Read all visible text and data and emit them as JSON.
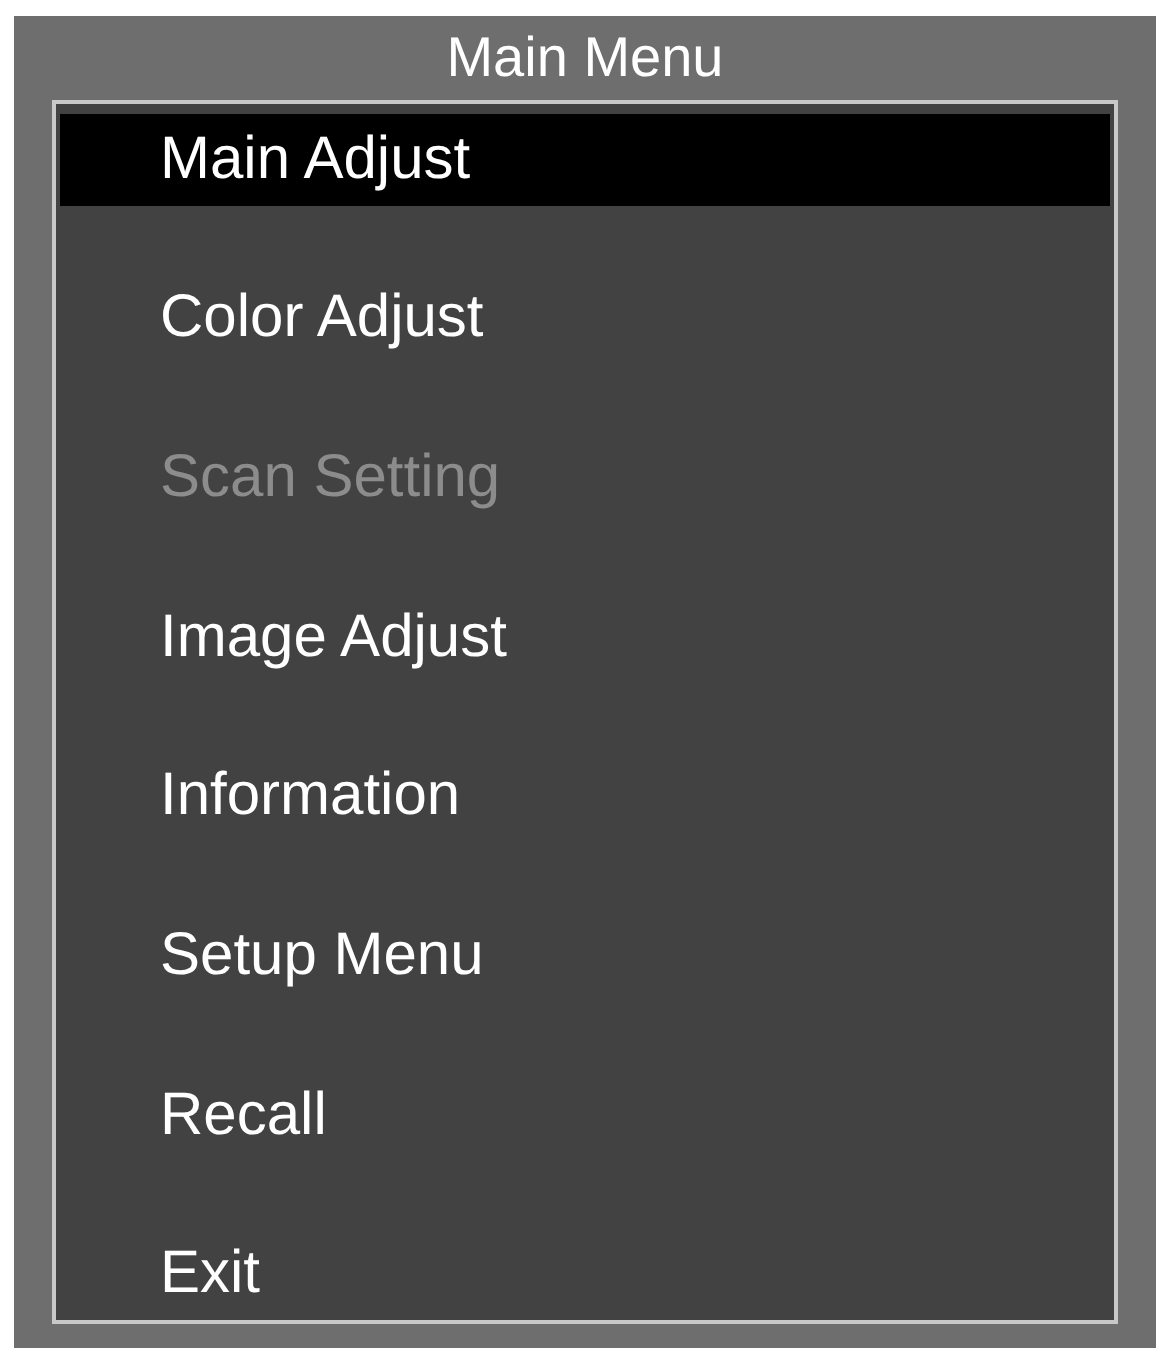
{
  "title": "Main Menu",
  "items": [
    {
      "label": "Main Adjust",
      "selected": true,
      "disabled": false
    },
    {
      "label": "Color Adjust",
      "selected": false,
      "disabled": false
    },
    {
      "label": "Scan Setting",
      "selected": false,
      "disabled": true
    },
    {
      "label": "Image Adjust",
      "selected": false,
      "disabled": false
    },
    {
      "label": "Information",
      "selected": false,
      "disabled": false
    },
    {
      "label": "Setup Menu",
      "selected": false,
      "disabled": false
    },
    {
      "label": "Recall",
      "selected": false,
      "disabled": false
    },
    {
      "label": "Exit",
      "selected": false,
      "disabled": false
    }
  ]
}
